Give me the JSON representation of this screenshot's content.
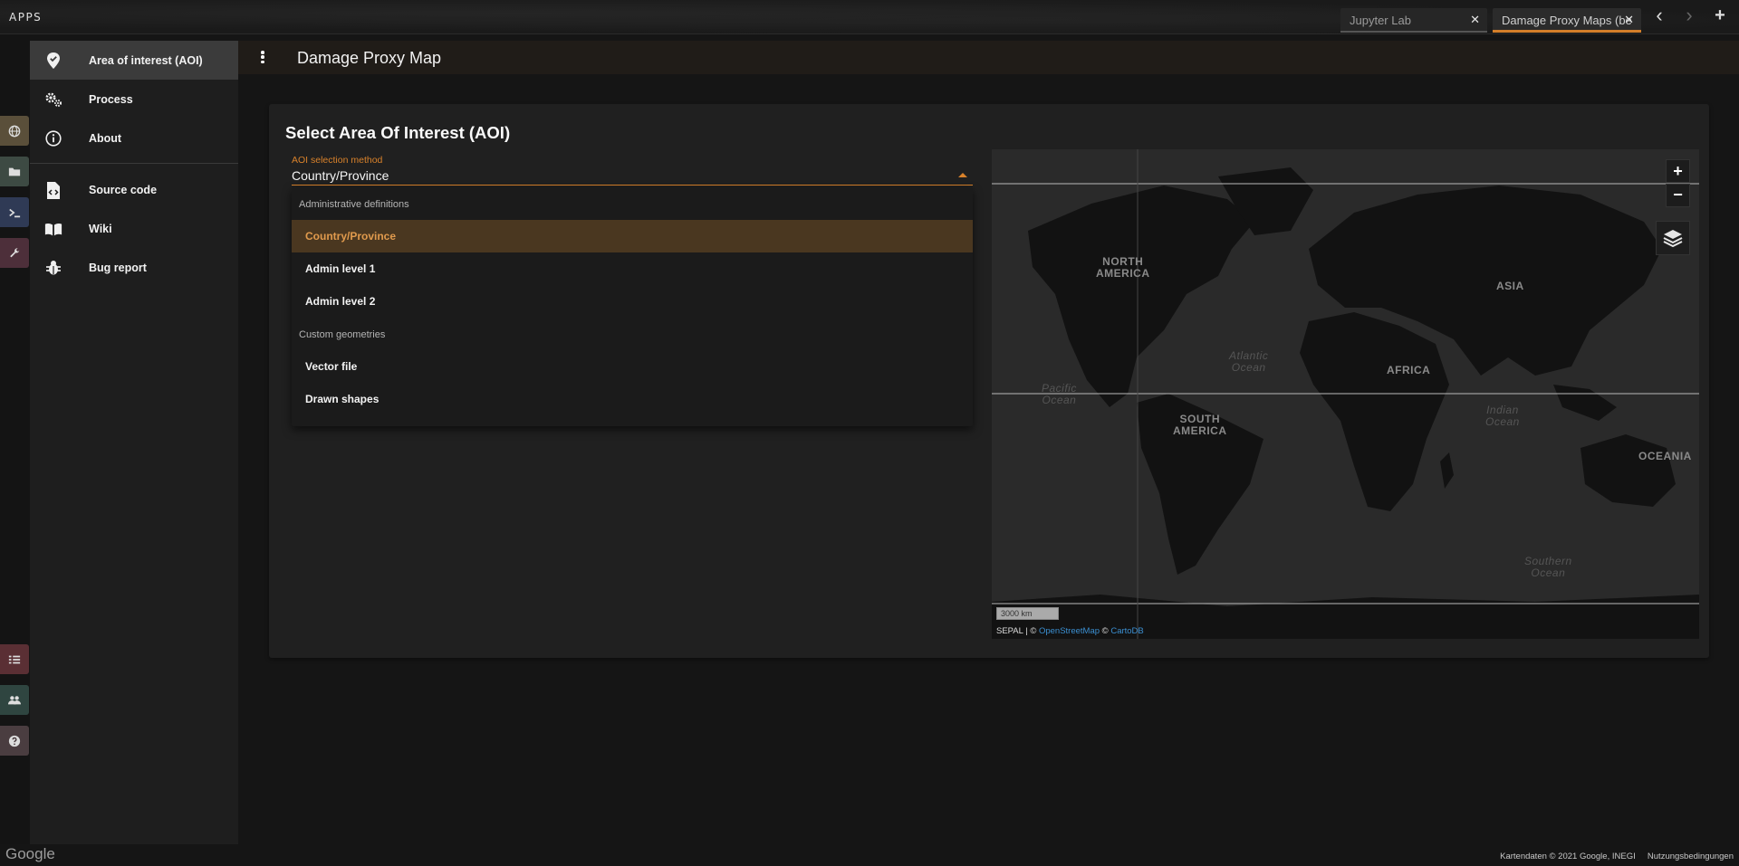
{
  "topbar": {
    "apps_label": "APPS",
    "tabs": [
      {
        "label": "Jupyter Lab",
        "close": "✕"
      },
      {
        "label": "Damage Proxy Maps (be",
        "close": "✕"
      }
    ],
    "prev_icon": "‹",
    "next_icon": "›",
    "add_icon": "+"
  },
  "rail": {
    "items": [
      {
        "icon": "globe-icon",
        "color": "#5a4f3a"
      },
      {
        "icon": "folder-icon",
        "color": "#3d4a43"
      },
      {
        "icon": "terminal-icon",
        "color": "#2f3a55"
      },
      {
        "icon": "wrench-icon",
        "color": "#4d2f3a"
      },
      {
        "icon": "tasks-icon",
        "color": "#5a2f34"
      },
      {
        "icon": "users-icon",
        "color": "#2f4540"
      },
      {
        "icon": "help-icon",
        "color": "#4a3d40"
      }
    ]
  },
  "drawer": {
    "items": [
      {
        "label": "Area of interest (AOI)",
        "icon": "map-marker-check-icon",
        "active": true
      },
      {
        "label": "Process",
        "icon": "cogs-icon"
      },
      {
        "label": "About",
        "icon": "info-circle-icon"
      },
      {
        "label": "Source code",
        "icon": "file-code-icon"
      },
      {
        "label": "Wiki",
        "icon": "book-open-icon"
      },
      {
        "label": "Bug report",
        "icon": "bug-icon"
      }
    ]
  },
  "appbar": {
    "title": "Damage Proxy Map"
  },
  "card": {
    "title": "Select Area Of Interest (AOI)",
    "select": {
      "label": "AOI selection method",
      "value": "Country/Province"
    },
    "menu": {
      "header_admin": "Administrative definitions",
      "items_admin": [
        "Country/Province",
        "Admin level 1",
        "Admin level 2"
      ],
      "header_custom": "Custom geometries",
      "items_custom": [
        "Vector file",
        "Drawn shapes"
      ]
    }
  },
  "map": {
    "labels": {
      "north_america": "NORTH\nAMERICA",
      "asia": "ASIA",
      "atlantic": "Atlantic\nOcean",
      "africa": "AFRICA",
      "pacific": "Pacific\nOcean",
      "south_america": "SOUTH\nAMERICA",
      "indian": "Indian\nOcean",
      "oceania": "OCEANIA",
      "southern": "Southern\nOcean"
    },
    "zoom_in": "+",
    "zoom_out": "−",
    "scale": "3000 km",
    "attribution_prefix": "SEPAL | © ",
    "attribution_osm": "OpenStreetMap",
    "attribution_sep": " © ",
    "attribution_carto": "CartoDB"
  },
  "footer": {
    "google": "Google",
    "data": "Kartendaten © 2021 Google, INEGI     Nutzungsbedingungen"
  }
}
